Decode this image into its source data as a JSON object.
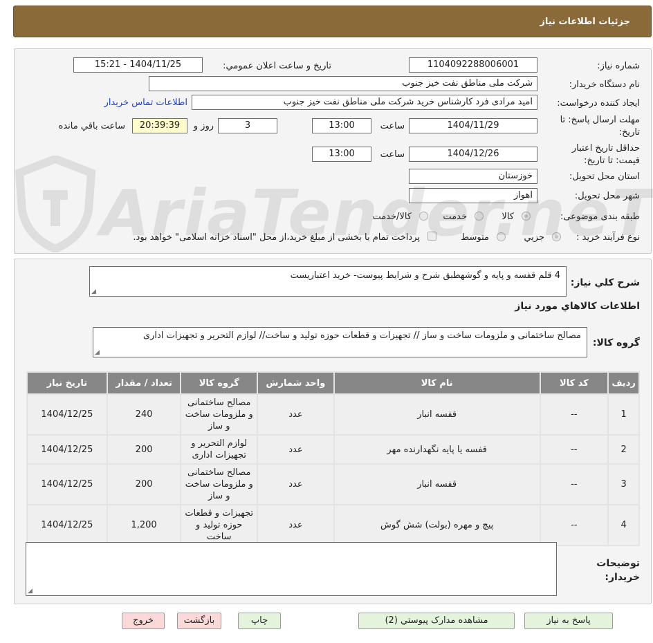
{
  "header": {
    "title": "جزئیات اطلاعات نیاز"
  },
  "details": {
    "need_number_label": "شماره نیاز:",
    "need_number": "1104092288006001",
    "announce_label": "تاریخ و ساعت اعلان عمومي:",
    "announce_value": "1404/11/25 - 15:21",
    "buyer_org_label": "نام دستگاه خریدار:",
    "buyer_org": "شرکت ملی مناطق نفت خیز جنوب",
    "requester_label": "ایجاد کننده درخواست:",
    "requester": "امید مرادی فرد کارشناس خرید شرکت ملی مناطق نفت خیز جنوب",
    "contact_link": "اطلاعات تماس خریدار",
    "deadline_label": "مهلت ارسال پاسخ: تا تاریخ:",
    "deadline_date": "1404/11/29",
    "time_label": "ساعت",
    "deadline_time": "13:00",
    "days_value": "3",
    "days_label": "روز و",
    "remaining_time": "20:39:39",
    "remaining_label": "ساعت باقي مانده",
    "validity_label": "حداقل تاریخ اعتبار قیمت: تا تاریخ:",
    "validity_date": "1404/12/26",
    "validity_time": "13:00",
    "province_label": "استان محل تحویل:",
    "province": "خوزستان",
    "city_label": "شهر محل تحویل:",
    "city": "اهواز",
    "category_label": "طبقه بندی موضوعی:",
    "category_options": [
      "کالا",
      "خدمت",
      "کالا/خدمت"
    ],
    "process_label": "نوع فرآیند خرید :",
    "process_options": [
      "جزیي",
      "متوسط"
    ],
    "process_note": "پرداخت تمام یا بخشی از مبلغ خرید،از محل \"اسناد خزانه اسلامی\" خواهد بود."
  },
  "summary": {
    "general_desc_label": "شرح کلي نیاز:",
    "general_desc": "4 قلم قفسه  و پایه و گوشهطبق شرح و شرایط پیوست- خرید اعتباریست",
    "items_info_title": "اطلاعات کالاهاي مورد نیاز",
    "group_label": "گروه کالا:",
    "group_value": "مصالح ساختمانی و ملزومات ساخت و ساز // تجهیزات و قطعات حوزه تولید و ساخت// لوازم التحریر و تجهیزات اداری",
    "buyer_notes_label": "توضیحات خریدار:",
    "buyer_notes": ""
  },
  "table": {
    "headers": [
      "ردیف",
      "کد کالا",
      "نام کالا",
      "واحد شمارش",
      "گروه کالا",
      "تعداد / مقدار",
      "تاریخ نیاز"
    ],
    "rows": [
      [
        "1",
        "--",
        "قفسه انبار",
        "عدد",
        "مصالح ساختمانی و ملزومات ساخت و ساز",
        "240",
        "1404/12/25"
      ],
      [
        "2",
        "--",
        "قفسه یا پایه نگهدارنده مهر",
        "عدد",
        "لوازم التحریر و تجهیزات اداری",
        "200",
        "1404/12/25"
      ],
      [
        "3",
        "--",
        "قفسه انبار",
        "عدد",
        "مصالح ساختمانی و ملزومات ساخت و ساز",
        "200",
        "1404/12/25"
      ],
      [
        "4",
        "--",
        "پیچ و مهره (بولت) شش گوش",
        "عدد",
        "تجهیزات و قطعات حوزه تولید و ساخت",
        "1,200",
        "1404/12/25"
      ]
    ]
  },
  "buttons": {
    "reply": "پاسخ به نیاز",
    "attachments": "مشاهده مدارک پیوستي (2)",
    "print": "چاپ",
    "back": "بازگشت",
    "exit": "خروج"
  },
  "watermark": {
    "text": "AriaTender.neT"
  },
  "colors": {
    "header_bg": "#8b6a3a",
    "table_header_bg": "#878787",
    "link": "#1c3fd6",
    "accent_green": "#e4f3dc",
    "accent_pink": "#fbd9d9"
  }
}
